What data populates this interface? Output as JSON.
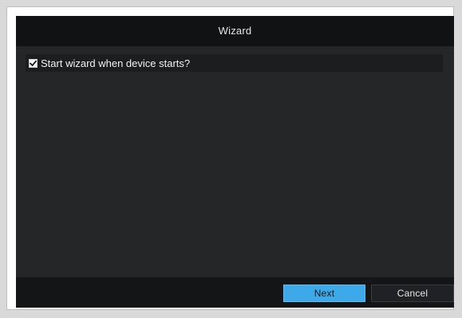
{
  "dialog": {
    "title": "Wizard",
    "start_wizard": {
      "label": "Start wizard when device starts?",
      "checked": true
    },
    "buttons": {
      "next_label": "Next",
      "cancel_label": "Cancel"
    }
  },
  "colors": {
    "title_bg": "#111214",
    "content_bg": "#242628",
    "primary_button": "#3da9e8"
  },
  "icons": {
    "checkbox_checked": "checkmark-icon"
  }
}
